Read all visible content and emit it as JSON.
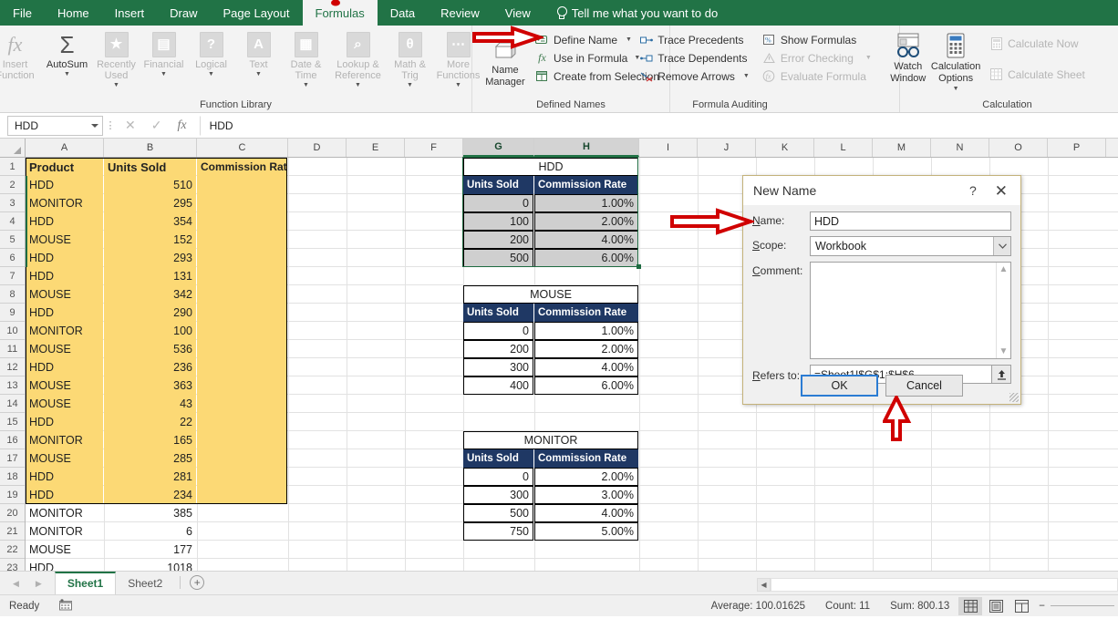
{
  "app": {
    "tabs": [
      {
        "label": "File",
        "active": false
      },
      {
        "label": "Home",
        "active": false
      },
      {
        "label": "Insert",
        "active": false
      },
      {
        "label": "Draw",
        "active": false
      },
      {
        "label": "Page Layout",
        "active": false
      },
      {
        "label": "Formulas",
        "active": true
      },
      {
        "label": "Data",
        "active": false
      },
      {
        "label": "Review",
        "active": false
      },
      {
        "label": "View",
        "active": false
      }
    ],
    "tellme": "Tell me what you want to do"
  },
  "ribbon": {
    "groups": [
      {
        "name": "Function Library",
        "label": "Function Library"
      },
      {
        "name": "Defined Names",
        "label": "Defined Names"
      },
      {
        "name": "Formula Auditing",
        "label": "Formula Auditing"
      },
      {
        "name": "Calculation",
        "label": "Calculation"
      }
    ],
    "function_library": [
      {
        "label": "Insert Function",
        "glyph": "fx",
        "two_line": true
      },
      {
        "label": "AutoSum",
        "glyph": "Σ",
        "caret": true
      },
      {
        "label": "Recently Used",
        "glyph": "★",
        "caret": true
      },
      {
        "label": "Financial",
        "glyph": "▤",
        "caret": true
      },
      {
        "label": "Logical",
        "glyph": "?",
        "caret": true
      },
      {
        "label": "Text",
        "glyph": "A",
        "caret": true
      },
      {
        "label": "Date & Time",
        "glyph": "▦",
        "caret": true
      },
      {
        "label": "Lookup & Reference",
        "glyph": "⌕",
        "caret": true
      },
      {
        "label": "Math & Trig",
        "glyph": "θ",
        "caret": true
      },
      {
        "label": "More Functions",
        "glyph": "…",
        "caret": true
      }
    ],
    "defined_names": {
      "name_manager": "Name Manager",
      "items": [
        {
          "label": "Define Name",
          "caret": true,
          "icon": "define-name-icon"
        },
        {
          "label": "Use in Formula",
          "caret": true,
          "icon": "use-in-formula-icon"
        },
        {
          "label": "Create from Selection",
          "caret": false,
          "icon": "create-from-selection-icon"
        }
      ]
    },
    "formula_auditing": [
      {
        "label": "Trace Precedents",
        "dim": false,
        "caret": false
      },
      {
        "label": "Show Formulas",
        "dim": false,
        "caret": false
      },
      {
        "label": "Trace Dependents",
        "dim": false,
        "caret": false
      },
      {
        "label": "Error Checking",
        "dim": true,
        "caret": true
      },
      {
        "label": "Remove Arrows",
        "dim": false,
        "caret": true
      },
      {
        "label": "Evaluate Formula",
        "dim": true,
        "caret": false
      }
    ],
    "watch_window": "Watch Window",
    "calculation": {
      "options_label": "Calculation Options",
      "calculate_now": "Calculate Now",
      "calculate_sheet": "Calculate Sheet"
    }
  },
  "formula_bar": {
    "name_box": "HDD",
    "value": "HDD",
    "cancel_icon": "✕",
    "enter_icon": "✓",
    "fx_icon": "fx"
  },
  "grid": {
    "columns": [
      "A",
      "B",
      "C",
      "D",
      "E",
      "F",
      "G",
      "H",
      "I",
      "J",
      "K",
      "L",
      "M",
      "N",
      "O",
      "P"
    ],
    "selected_columns": [
      "G",
      "H"
    ],
    "row_count": 23,
    "headers": {
      "a": "Product",
      "b": "Units Sold",
      "c": "Commission Rate"
    },
    "rows": [
      {
        "n": 2,
        "product": "HDD",
        "units": "510",
        "highlight": true
      },
      {
        "n": 3,
        "product": "MONITOR",
        "units": "295",
        "highlight": true
      },
      {
        "n": 4,
        "product": "HDD",
        "units": "354",
        "highlight": true
      },
      {
        "n": 5,
        "product": "MOUSE",
        "units": "152",
        "highlight": true
      },
      {
        "n": 6,
        "product": "HDD",
        "units": "293",
        "highlight": true
      },
      {
        "n": 7,
        "product": "HDD",
        "units": "131",
        "highlight": true
      },
      {
        "n": 8,
        "product": "MOUSE",
        "units": "342",
        "highlight": true
      },
      {
        "n": 9,
        "product": "HDD",
        "units": "290",
        "highlight": true
      },
      {
        "n": 10,
        "product": "MONITOR",
        "units": "100",
        "highlight": true
      },
      {
        "n": 11,
        "product": "MOUSE",
        "units": "536",
        "highlight": true
      },
      {
        "n": 12,
        "product": "HDD",
        "units": "236",
        "highlight": true
      },
      {
        "n": 13,
        "product": "MOUSE",
        "units": "363",
        "highlight": true
      },
      {
        "n": 14,
        "product": "MOUSE",
        "units": "43",
        "highlight": true
      },
      {
        "n": 15,
        "product": "HDD",
        "units": "22",
        "highlight": true
      },
      {
        "n": 16,
        "product": "MONITOR",
        "units": "165",
        "highlight": true
      },
      {
        "n": 17,
        "product": "MOUSE",
        "units": "285",
        "highlight": true
      },
      {
        "n": 18,
        "product": "HDD",
        "units": "281",
        "highlight": true
      },
      {
        "n": 19,
        "product": "HDD",
        "units": "234",
        "highlight": true
      },
      {
        "n": 20,
        "product": "MONITOR",
        "units": "385",
        "highlight": false
      },
      {
        "n": 21,
        "product": "MONITOR",
        "units": "6",
        "highlight": false
      },
      {
        "n": 22,
        "product": "MOUSE",
        "units": "177",
        "highlight": false
      },
      {
        "n": 23,
        "product": "HDD",
        "units": "1018",
        "highlight": false
      }
    ],
    "lookup_tables": [
      {
        "title": "HDD",
        "selected": true,
        "col_headers": [
          "Units Sold",
          "Commission Rate"
        ],
        "rows": [
          [
            "0",
            "1.00%"
          ],
          [
            "100",
            "2.00%"
          ],
          [
            "200",
            "4.00%"
          ],
          [
            "500",
            "6.00%"
          ]
        ]
      },
      {
        "title": "MOUSE",
        "selected": false,
        "col_headers": [
          "Units Sold",
          "Commission Rate"
        ],
        "rows": [
          [
            "0",
            "1.00%"
          ],
          [
            "200",
            "2.00%"
          ],
          [
            "300",
            "4.00%"
          ],
          [
            "400",
            "6.00%"
          ]
        ]
      },
      {
        "title": "MONITOR",
        "selected": false,
        "col_headers": [
          "Units Sold",
          "Commission Rate"
        ],
        "rows": [
          [
            "0",
            "2.00%"
          ],
          [
            "300",
            "3.00%"
          ],
          [
            "500",
            "4.00%"
          ],
          [
            "750",
            "5.00%"
          ]
        ]
      }
    ]
  },
  "dialog": {
    "title": "New Name",
    "help_glyph": "?",
    "close_glyph": "✕",
    "name_label": "Name:",
    "name_value": "HDD",
    "scope_label": "Scope:",
    "scope_value": "Workbook",
    "comment_label": "Comment:",
    "comment_value": "",
    "refers_to_label": "Refers to:",
    "refers_to_value": "=Sheet1!$G$1:$H$6",
    "ok_label": "OK",
    "cancel_label": "Cancel"
  },
  "sheet_tabs": {
    "tabs": [
      {
        "label": "Sheet1",
        "active": true
      },
      {
        "label": "Sheet2",
        "active": false
      }
    ],
    "add_label": "+"
  },
  "status_bar": {
    "mode": "Ready",
    "average": "Average: 100.01625",
    "count": "Count: 11",
    "sum": "Sum: 800.13",
    "views": [
      "normal-view",
      "page-layout-view",
      "page-break-view"
    ],
    "zoom_minus": "−"
  },
  "colors": {
    "excel_green": "#217346",
    "highlight_yellow": "#fcd975",
    "table_header_navy": "#1f3864",
    "annotation_red": "#d00000",
    "selection_green": "#1e6b41"
  }
}
